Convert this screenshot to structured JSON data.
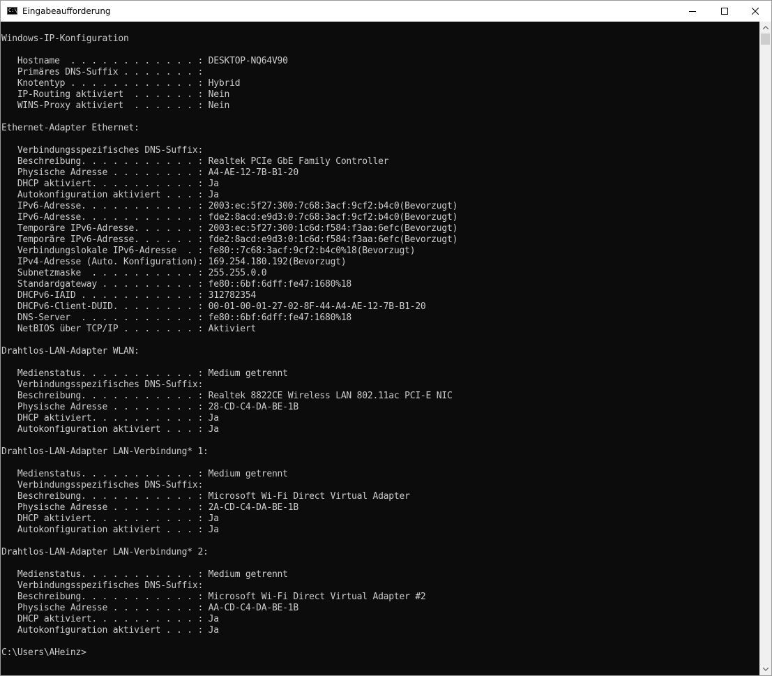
{
  "window": {
    "title": "Eingabeaufforderung",
    "icon": "cmd-icon",
    "controls": {
      "minimize": "minimize-icon",
      "maximize": "maximize-icon",
      "close": "close-icon"
    }
  },
  "console": {
    "lines": [
      "Windows-IP-Konfiguration",
      "",
      "   Hostname  . . . . . . . . . . . . : DESKTOP-NQ64V90",
      "   Primäres DNS-Suffix . . . . . . . :",
      "   Knotentyp . . . . . . . . . . . . : Hybrid",
      "   IP-Routing aktiviert  . . . . . . : Nein",
      "   WINS-Proxy aktiviert  . . . . . . : Nein",
      "",
      "Ethernet-Adapter Ethernet:",
      "",
      "   Verbindungsspezifisches DNS-Suffix:",
      "   Beschreibung. . . . . . . . . . . : Realtek PCIe GbE Family Controller",
      "   Physische Adresse . . . . . . . . : A4-AE-12-7B-B1-20",
      "   DHCP aktiviert. . . . . . . . . . : Ja",
      "   Autokonfiguration aktiviert . . . : Ja",
      "   IPv6-Adresse. . . . . . . . . . . : 2003:ec:5f27:300:7c68:3acf:9cf2:b4c0(Bevorzugt)",
      "   IPv6-Adresse. . . . . . . . . . . : fde2:8acd:e9d3:0:7c68:3acf:9cf2:b4c0(Bevorzugt)",
      "   Temporäre IPv6-Adresse. . . . . . : 2003:ec:5f27:300:1c6d:f584:f3aa:6efc(Bevorzugt)",
      "   Temporäre IPv6-Adresse. . . . . . : fde2:8acd:e9d3:0:1c6d:f584:f3aa:6efc(Bevorzugt)",
      "   Verbindungslokale IPv6-Adresse  . : fe80::7c68:3acf:9cf2:b4c0%18(Bevorzugt)",
      "   IPv4-Adresse (Auto. Konfiguration): 169.254.180.192(Bevorzugt)",
      "   Subnetzmaske  . . . . . . . . . . : 255.255.0.0",
      "   Standardgateway . . . . . . . . . : fe80::6bf:6dff:fe47:1680%18",
      "   DHCPv6-IAID . . . . . . . . . . . : 312782354",
      "   DHCPv6-Client-DUID. . . . . . . . : 00-01-00-01-27-02-8F-44-A4-AE-12-7B-B1-20",
      "   DNS-Server  . . . . . . . . . . . : fe80::6bf:6dff:fe47:1680%18",
      "   NetBIOS über TCP/IP . . . . . . . : Aktiviert",
      "",
      "Drahtlos-LAN-Adapter WLAN:",
      "",
      "   Medienstatus. . . . . . . . . . . : Medium getrennt",
      "   Verbindungsspezifisches DNS-Suffix:",
      "   Beschreibung. . . . . . . . . . . : Realtek 8822CE Wireless LAN 802.11ac PCI-E NIC",
      "   Physische Adresse . . . . . . . . : 28-CD-C4-DA-BE-1B",
      "   DHCP aktiviert. . . . . . . . . . : Ja",
      "   Autokonfiguration aktiviert . . . : Ja",
      "",
      "Drahtlos-LAN-Adapter LAN-Verbindung* 1:",
      "",
      "   Medienstatus. . . . . . . . . . . : Medium getrennt",
      "   Verbindungsspezifisches DNS-Suffix:",
      "   Beschreibung. . . . . . . . . . . : Microsoft Wi-Fi Direct Virtual Adapter",
      "   Physische Adresse . . . . . . . . : 2A-CD-C4-DA-BE-1B",
      "   DHCP aktiviert. . . . . . . . . . : Ja",
      "   Autokonfiguration aktiviert . . . : Ja",
      "",
      "Drahtlos-LAN-Adapter LAN-Verbindung* 2:",
      "",
      "   Medienstatus. . . . . . . . . . . : Medium getrennt",
      "   Verbindungsspezifisches DNS-Suffix:",
      "   Beschreibung. . . . . . . . . . . : Microsoft Wi-Fi Direct Virtual Adapter #2",
      "   Physische Adresse . . . . . . . . : AA-CD-C4-DA-BE-1B",
      "   DHCP aktiviert. . . . . . . . . . : Ja",
      "   Autokonfiguration aktiviert . . . : Ja",
      "",
      "C:\\Users\\AHeinz>"
    ],
    "colors": {
      "background": "#0c0c0c",
      "foreground": "#cccccc"
    }
  },
  "scrollbar": {
    "up_icon": "scroll-up-arrow-icon",
    "down_icon": "scroll-down-arrow-icon"
  }
}
